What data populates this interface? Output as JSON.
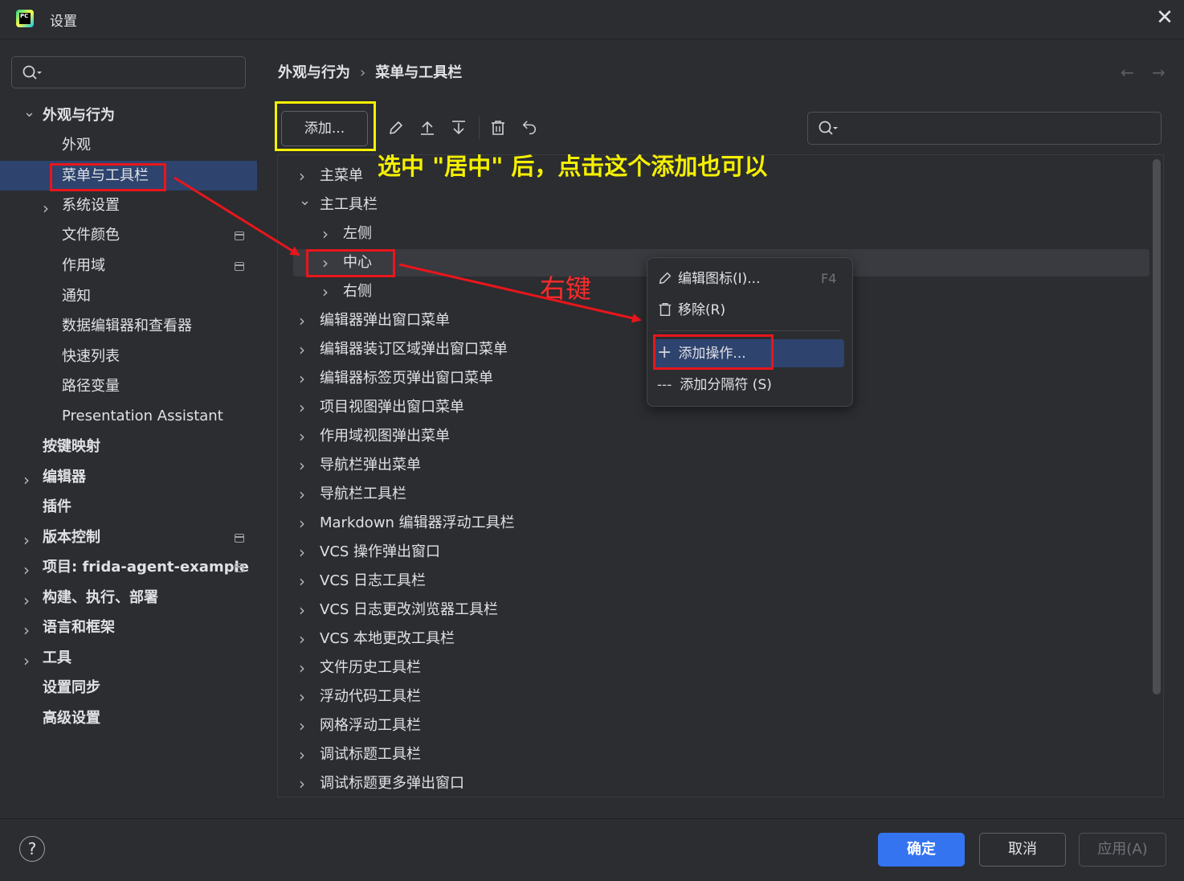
{
  "window": {
    "title": "设置",
    "app_icon_text": "PC"
  },
  "left_nav": {
    "items": [
      {
        "label": "外观与行为",
        "expanded": true,
        "bold": true
      },
      {
        "label": "外观"
      },
      {
        "label": "菜单与工具栏",
        "selected": true
      },
      {
        "label": "系统设置",
        "expandable": true
      },
      {
        "label": "文件颜色",
        "project_badge": true
      },
      {
        "label": "作用域",
        "project_badge": true
      },
      {
        "label": "通知"
      },
      {
        "label": "数据编辑器和查看器"
      },
      {
        "label": "快速列表"
      },
      {
        "label": "路径变量"
      },
      {
        "label": "Presentation Assistant"
      },
      {
        "label": "按键映射",
        "bold": true
      },
      {
        "label": "编辑器",
        "bold": true,
        "expandable": true
      },
      {
        "label": "插件",
        "bold": true
      },
      {
        "label": "版本控制",
        "bold": true,
        "expandable": true,
        "project_badge": true
      },
      {
        "label": "项目: frida-agent-example",
        "bold": true,
        "expandable": true,
        "project_badge": true
      },
      {
        "label": "构建、执行、部署",
        "bold": true,
        "expandable": true
      },
      {
        "label": "语言和框架",
        "bold": true,
        "expandable": true
      },
      {
        "label": "工具",
        "bold": true,
        "expandable": true
      },
      {
        "label": "设置同步",
        "bold": true
      },
      {
        "label": "高级设置",
        "bold": true
      }
    ]
  },
  "breadcrumb": {
    "parent": "外观与行为",
    "separator": "›",
    "current": "菜单与工具栏"
  },
  "nav_arrows": {
    "back": "←",
    "forward": "→"
  },
  "toolbar": {
    "add_label": "添加..."
  },
  "tree": {
    "items": [
      {
        "label": "主菜单",
        "chevron": "›"
      },
      {
        "label": "主工具栏",
        "chevron": "⌄",
        "expanded": true
      },
      {
        "label": "左侧",
        "chevron": "›",
        "child": true
      },
      {
        "label": "中心",
        "chevron": "›",
        "child": true,
        "highlighted": true
      },
      {
        "label": "右侧",
        "chevron": "›",
        "child": true
      },
      {
        "label": "编辑器弹出窗口菜单",
        "chevron": "›"
      },
      {
        "label": "编辑器装订区域弹出窗口菜单",
        "chevron": "›"
      },
      {
        "label": "编辑器标签页弹出窗口菜单",
        "chevron": "›"
      },
      {
        "label": "项目视图弹出窗口菜单",
        "chevron": "›"
      },
      {
        "label": "作用域视图弹出菜单",
        "chevron": "›"
      },
      {
        "label": "导航栏弹出菜单",
        "chevron": "›"
      },
      {
        "label": "导航栏工具栏",
        "chevron": "›"
      },
      {
        "label": "Markdown 编辑器浮动工具栏",
        "chevron": "›"
      },
      {
        "label": "VCS 操作弹出窗口",
        "chevron": "›"
      },
      {
        "label": "VCS 日志工具栏",
        "chevron": "›"
      },
      {
        "label": "VCS 日志更改浏览器工具栏",
        "chevron": "›"
      },
      {
        "label": "VCS 本地更改工具栏",
        "chevron": "›"
      },
      {
        "label": "文件历史工具栏",
        "chevron": "›"
      },
      {
        "label": "浮动代码工具栏",
        "chevron": "›"
      },
      {
        "label": "网格浮动工具栏",
        "chevron": "›"
      },
      {
        "label": "调试标题工具栏",
        "chevron": "›"
      },
      {
        "label": "调试标题更多弹出窗口",
        "chevron": "›"
      }
    ]
  },
  "context_menu": {
    "edit_icon_label": "编辑图标(I)...",
    "edit_icon_shortcut": "F4",
    "remove_label": "移除(R)",
    "add_action_label": "添加操作...",
    "add_separator_label": "添加分隔符 (S)",
    "separator_glyph": "---"
  },
  "annotations": {
    "yellow_note": "选中 \"居中\" 后，点击这个添加也可以",
    "right_click_note": "右键"
  },
  "footer": {
    "help": "?",
    "ok": "确定",
    "cancel": "取消",
    "apply": "应用(A)"
  },
  "colors": {
    "accent": "#3574f0",
    "selection": "#2e436e",
    "annotation_yellow": "#f5f000",
    "annotation_red": "#e8161c"
  }
}
